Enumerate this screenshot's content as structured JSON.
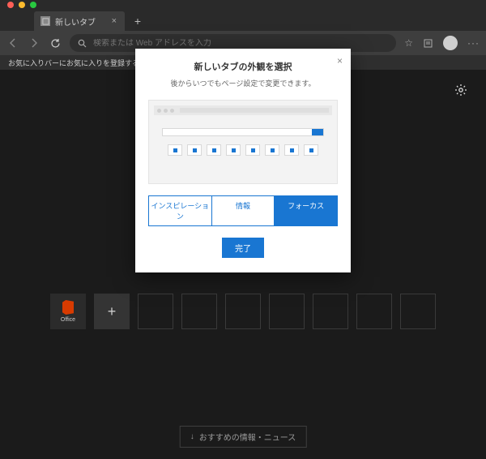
{
  "tab": {
    "title": "新しいタブ"
  },
  "address": {
    "placeholder": "検索または Web アドレスを入力"
  },
  "bookmarks_bar": {
    "hint": "お気に入りバーにお気に入りを登録すると、簡単にアクセスできます"
  },
  "tiles": {
    "office_label": "Office"
  },
  "news_button": {
    "label": "おすすめの情報・ニュース"
  },
  "modal": {
    "title": "新しいタブの外観を選択",
    "subtitle": "後からいつでもページ設定で変更できます。",
    "options": {
      "inspiration": "インスピレーション",
      "info": "情報",
      "focus": "フォーカス"
    },
    "selected": "focus",
    "done": "完了"
  },
  "colors": {
    "accent": "#1976d2",
    "office": "#d83b01"
  }
}
